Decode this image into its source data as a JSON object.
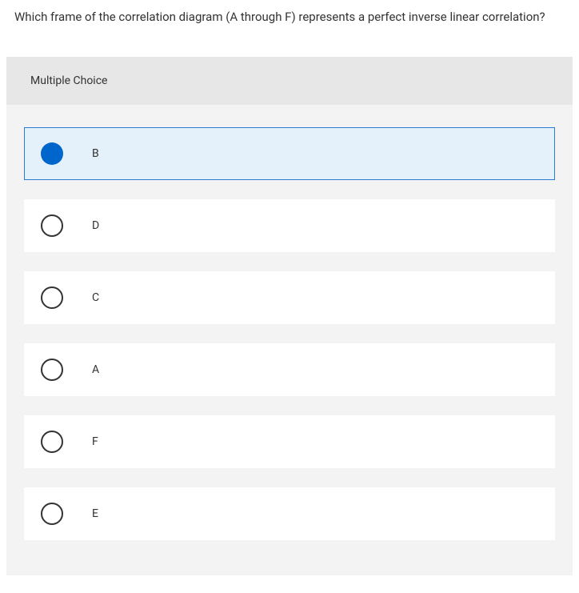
{
  "question": "Which frame of the correlation diagram (A through F) represents a perfect inverse linear correlation?",
  "section_title": "Multiple Choice",
  "options": [
    {
      "label": "B",
      "selected": true
    },
    {
      "label": "D",
      "selected": false
    },
    {
      "label": "C",
      "selected": false
    },
    {
      "label": "A",
      "selected": false
    },
    {
      "label": "F",
      "selected": false
    },
    {
      "label": "E",
      "selected": false
    }
  ]
}
